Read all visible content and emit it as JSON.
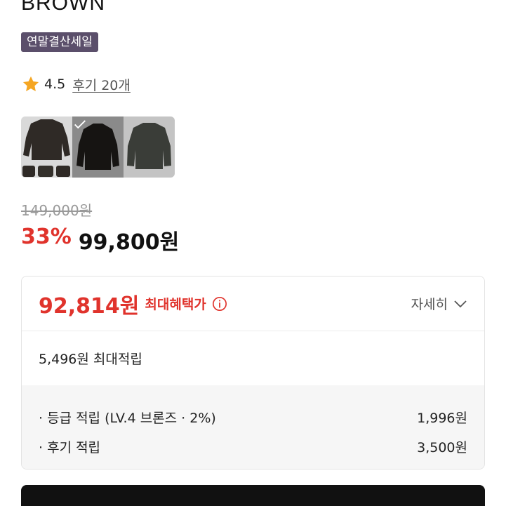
{
  "product": {
    "brand": "BROWN",
    "sale_badge": "연말결산세일",
    "rating": "4.5",
    "reviews_link": "후기 20개",
    "original_price": "149,000원",
    "discount": "33%",
    "sale_price": "99,800원"
  },
  "thumbnails": [
    {
      "name": "thumbnail-1",
      "selected": false
    },
    {
      "name": "thumbnail-2",
      "selected": true
    },
    {
      "name": "thumbnail-3",
      "selected": false
    }
  ],
  "benefit": {
    "max_price": "92,814원",
    "max_label": "최대혜택가",
    "detail_label": "자세히",
    "max_points": "5,496원 최대적립",
    "rows": [
      {
        "label": "· 등급 적립 (LV.4 브론즈 · 2%)",
        "value": "1,996원"
      },
      {
        "label": "· 후기 적립",
        "value": "3,500원"
      }
    ]
  },
  "colors": {
    "accent_red": "#e0332c",
    "badge_purple": "#5b4f6b",
    "star": "#f5a623"
  },
  "icons": [
    "star-icon",
    "check-icon",
    "info-icon",
    "chevron-down-icon"
  ]
}
